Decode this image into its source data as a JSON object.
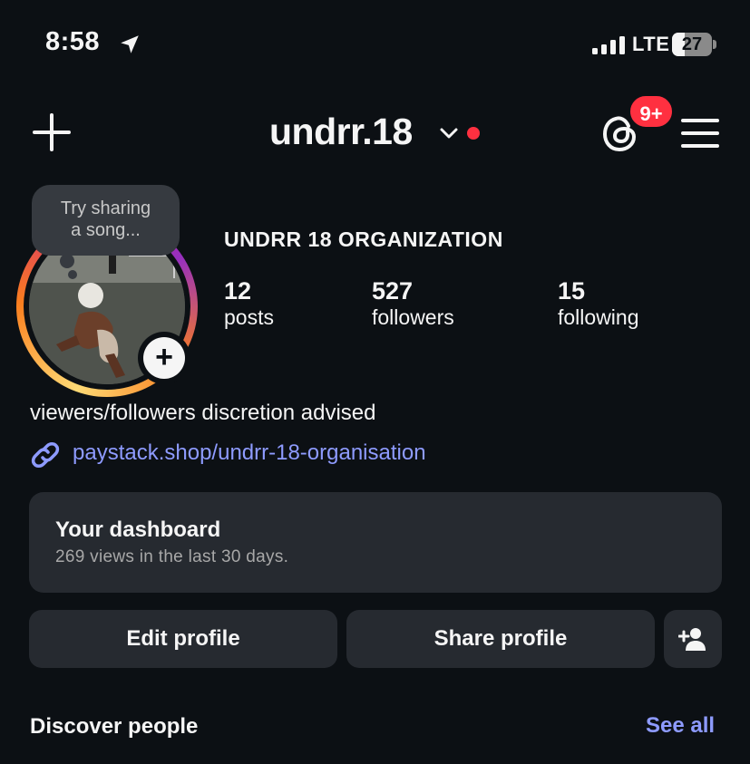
{
  "status_bar": {
    "time": "8:58",
    "network": "LTE",
    "battery": "27"
  },
  "header": {
    "username": "undrr.18",
    "notification_badge": "9+"
  },
  "avatar": {
    "note_prompt": [
      "Try sharing",
      "a song..."
    ]
  },
  "profile": {
    "full_name": "UNDRR 18 ORGANIZATION",
    "stats": [
      {
        "value": "12",
        "label": "posts"
      },
      {
        "value": "527",
        "label": "followers"
      },
      {
        "value": "15",
        "label": "following"
      }
    ],
    "bio": "viewers/followers discretion advised",
    "link": "paystack.shop/undrr-18-organisation"
  },
  "dashboard": {
    "title": "Your dashboard",
    "subtitle": "269 views in the last 30 days."
  },
  "actions": {
    "edit_label": "Edit profile",
    "share_label": "Share profile"
  },
  "discover": {
    "title": "Discover people",
    "see_all": "See all"
  },
  "colors": {
    "background": "#0c1014",
    "card": "#262a30",
    "link": "#8e9bff",
    "badge": "#ff3040"
  },
  "icons": [
    "location-arrow-icon",
    "signal-icon",
    "battery-icon",
    "plus-icon",
    "chevron-down-icon",
    "threads-icon",
    "menu-icon",
    "link-icon",
    "add-person-icon"
  ]
}
